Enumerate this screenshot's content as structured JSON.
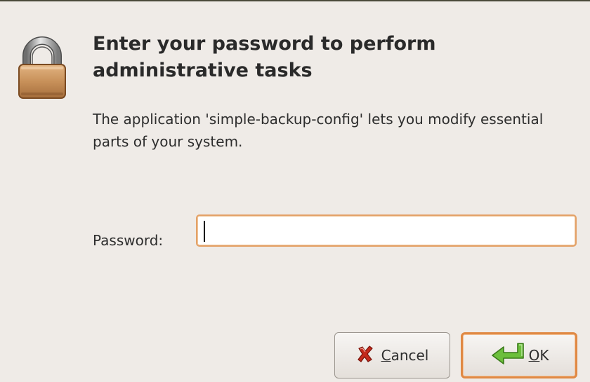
{
  "dialog": {
    "heading": "Enter your password to perform administrative tasks",
    "description": "The application 'simple-backup-config' lets you modify essential parts of your system.",
    "password_label": "Password:",
    "password_value": "",
    "cancel_mnemonic": "C",
    "cancel_rest": "ancel",
    "ok_mnemonic": "O",
    "ok_rest": "K"
  },
  "icons": {
    "lock": "lock-icon",
    "cancel": "red-x-icon",
    "ok": "green-enter-arrow-icon"
  },
  "colors": {
    "focus_border": "#e3a167",
    "default_button_border": "#e08944",
    "background": "#efebe7",
    "lock_body": "#c8915a",
    "cancel_icon": "#c42a1c",
    "ok_icon": "#6cbf3c"
  }
}
